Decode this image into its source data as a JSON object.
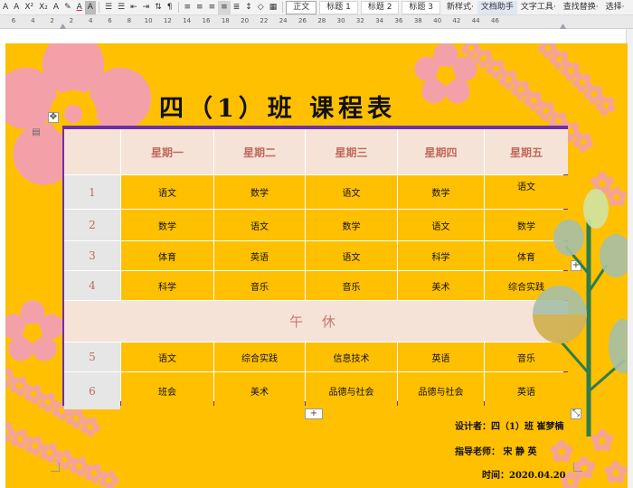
{
  "toolbar": {
    "items": [
      "A",
      "A",
      "X²",
      "X₂",
      "A",
      "✎",
      "A",
      "A"
    ],
    "style_normal": "正文",
    "style_h1": "标题 1",
    "style_h2": "标题 2",
    "style_h3": "标题 3",
    "new_style": "新样式·",
    "doc_assistant": "文档助手",
    "text_tools": "文字工具·",
    "find_replace": "查找替换·",
    "select": "选择·"
  },
  "ruler": {
    "numbers": [
      "6",
      "4",
      "2",
      "2",
      "4",
      "6",
      "8",
      "10",
      "12",
      "14",
      "16",
      "18",
      "20",
      "22",
      "24",
      "26",
      "28",
      "30",
      "32",
      "34",
      "36",
      "38",
      "40",
      "42",
      "44",
      "46"
    ]
  },
  "document": {
    "title": "四（1）班   课程表",
    "lunch": "午 休",
    "designer": "设计者：四（1）班 崔梦楠",
    "advisor": "指导老师： 宋 静 英",
    "date": "时间：2020.04.20"
  },
  "table": {
    "headers": [
      "星期一",
      "星期二",
      "星期三",
      "星期四",
      "星期五"
    ],
    "rows": [
      {
        "num": "1",
        "cells": [
          "语文",
          "数学",
          "语文",
          "数学",
          "语文"
        ]
      },
      {
        "num": "2",
        "cells": [
          "数学",
          "语文",
          "数学",
          "语文",
          "数学"
        ]
      },
      {
        "num": "3",
        "cells": [
          "体育",
          "英语",
          "语文",
          "科学",
          "体育"
        ]
      },
      {
        "num": "4",
        "cells": [
          "科学",
          "音乐",
          "音乐",
          "美术",
          "综合实践"
        ]
      },
      {
        "num": "5",
        "cells": [
          "语文",
          "综合实践",
          "信息技术",
          "英语",
          "音乐"
        ]
      },
      {
        "num": "6",
        "cells": [
          "班会",
          "美术",
          "品德与社会",
          "品德与社会",
          "英语"
        ]
      }
    ]
  },
  "colors": {
    "page": "#fec001",
    "border": "#7030a0",
    "header_bg": "#f6e3d8",
    "header_text": "#c06a5c",
    "flower": "#f4a0a8",
    "tree_trunk": "#2e7d4c"
  },
  "icons": {
    "move": "move-icon",
    "add": "plus-icon",
    "resize": "resize-icon"
  }
}
